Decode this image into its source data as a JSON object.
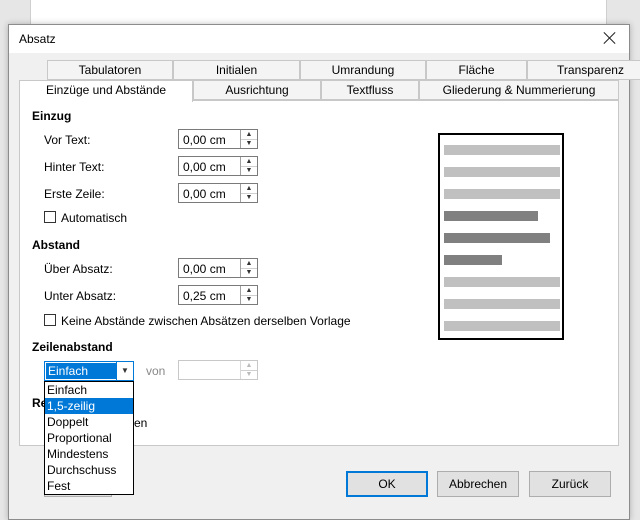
{
  "dialog": {
    "title": "Absatz"
  },
  "tabs_back": [
    "Tabulatoren",
    "Initialen",
    "Umrandung",
    "Fläche",
    "Transparenz"
  ],
  "tabs_front": [
    "Einzüge und Abstände",
    "Ausrichtung",
    "Textfluss",
    "Gliederung & Nummerierung"
  ],
  "einzug": {
    "heading": "Einzug",
    "vor_text": {
      "label": "Vor Text:",
      "value": "0,00 cm"
    },
    "hinter_text": {
      "label": "Hinter Text:",
      "value": "0,00 cm"
    },
    "erste_zeile": {
      "label": "Erste Zeile:",
      "value": "0,00 cm"
    },
    "automatisch": "Automatisch"
  },
  "abstand": {
    "heading": "Abstand",
    "ueber": {
      "label": "Über Absatz:",
      "value": "0,00 cm"
    },
    "unter": {
      "label": "Unter Absatz:",
      "value": "0,25 cm"
    },
    "keine": "Keine Abstände zwischen Absätzen derselben Vorlage"
  },
  "zeilenabstand": {
    "heading": "Zeilenabstand",
    "selected": "Einfach",
    "von_label": "von",
    "von_value": "",
    "options": [
      "Einfach",
      "1,5-zeilig",
      "Doppelt",
      "Proportional",
      "Mindestens",
      "Durchschuss",
      "Fest"
    ],
    "highlighted": "1,5-zeilig"
  },
  "partial_text": {
    "section_fragment": "Re",
    "checkbox_fragment": "en"
  },
  "buttons": {
    "ok": "OK",
    "abbrechen": "Abbrechen",
    "zurueck": "Zurück"
  },
  "colors": {
    "accent": "#0078d7",
    "preview_light": "#c0c0c0",
    "preview_dark": "#808080"
  },
  "icons": {
    "close": "close-icon",
    "spin_up": "spin-up-icon",
    "spin_down": "spin-down-icon",
    "dropdown": "chevron-down-icon"
  }
}
